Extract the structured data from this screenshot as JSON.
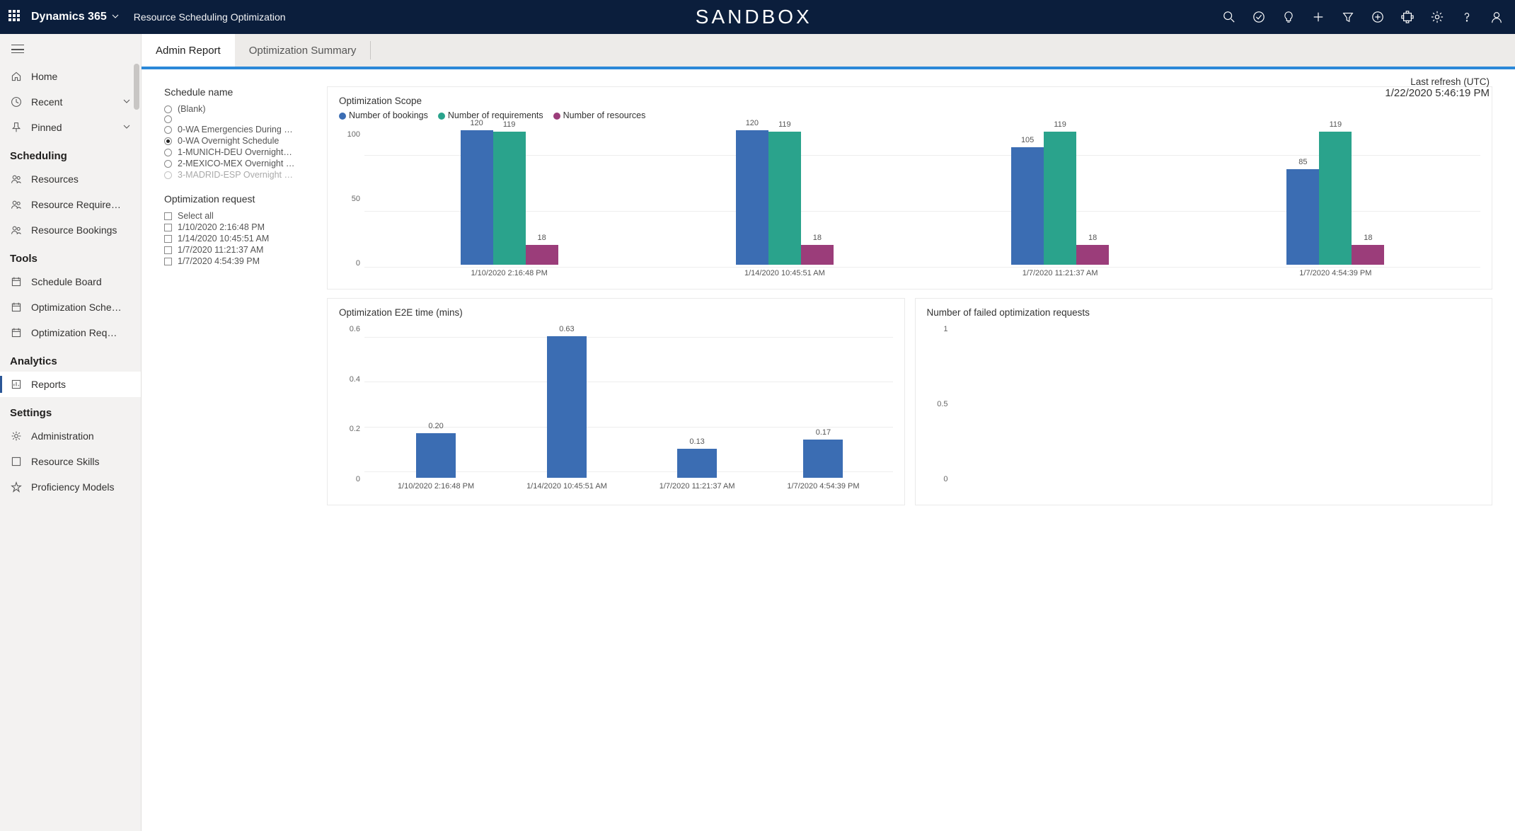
{
  "header": {
    "brand": "Dynamics 365",
    "app": "Resource Scheduling Optimization",
    "env_label": "SANDBOX"
  },
  "sidebar": {
    "top": [
      {
        "label": "Home",
        "icon": "home"
      },
      {
        "label": "Recent",
        "icon": "clock",
        "expandable": true
      },
      {
        "label": "Pinned",
        "icon": "pin",
        "expandable": true
      }
    ],
    "sections": [
      {
        "title": "Scheduling",
        "items": [
          {
            "label": "Resources"
          },
          {
            "label": "Resource Require…"
          },
          {
            "label": "Resource Bookings"
          }
        ]
      },
      {
        "title": "Tools",
        "items": [
          {
            "label": "Schedule Board"
          },
          {
            "label": "Optimization Sche…"
          },
          {
            "label": "Optimization Req…"
          }
        ]
      },
      {
        "title": "Analytics",
        "items": [
          {
            "label": "Reports",
            "active": true
          }
        ]
      },
      {
        "title": "Settings",
        "items": [
          {
            "label": "Administration"
          },
          {
            "label": "Resource Skills"
          },
          {
            "label": "Proficiency Models"
          }
        ]
      }
    ]
  },
  "tabs": {
    "active": "Admin Report",
    "other": "Optimization Summary"
  },
  "refresh": {
    "label": "Last refresh (UTC)",
    "value": "1/22/2020 5:46:19 PM"
  },
  "filters": {
    "schedule_name": {
      "title": "Schedule name",
      "options": [
        {
          "label": "(Blank)",
          "selected": false
        },
        {
          "label": "",
          "selected": false
        },
        {
          "label": "0-WA Emergencies During …",
          "selected": false
        },
        {
          "label": "0-WA Overnight Schedule",
          "selected": true
        },
        {
          "label": "1-MUNICH-DEU Overnight…",
          "selected": false
        },
        {
          "label": "2-MEXICO-MEX Overnight …",
          "selected": false
        },
        {
          "label": "3-MADRID-ESP Overnight …",
          "selected": false,
          "cut": true
        }
      ]
    },
    "optimization_request": {
      "title": "Optimization request",
      "options": [
        {
          "label": "Select all"
        },
        {
          "label": "1/10/2020 2:16:48 PM"
        },
        {
          "label": "1/14/2020 10:45:51 AM"
        },
        {
          "label": "1/7/2020 11:21:37 AM"
        },
        {
          "label": "1/7/2020 4:54:39 PM"
        }
      ]
    }
  },
  "chart_data": [
    {
      "id": "scope",
      "type": "bar",
      "title": "Optimization Scope",
      "legend": [
        {
          "name": "Number of bookings",
          "color": "#3b6db3"
        },
        {
          "name": "Number of requirements",
          "color": "#2aa38c"
        },
        {
          "name": "Number of resources",
          "color": "#9b3d7a"
        }
      ],
      "categories": [
        "1/10/2020 2:16:48 PM",
        "1/14/2020 10:45:51 AM",
        "1/7/2020 11:21:37 AM",
        "1/7/2020 4:54:39 PM"
      ],
      "series": [
        {
          "name": "Number of bookings",
          "values": [
            120,
            120,
            105,
            85
          ]
        },
        {
          "name": "Number of requirements",
          "values": [
            119,
            119,
            119,
            119
          ]
        },
        {
          "name": "Number of resources",
          "values": [
            18,
            18,
            18,
            18
          ]
        }
      ],
      "y_ticks": [
        0,
        50,
        100
      ],
      "ylim": [
        0,
        120
      ]
    },
    {
      "id": "e2e",
      "type": "bar",
      "title": "Optimization E2E time (mins)",
      "categories": [
        "1/10/2020 2:16:48 PM",
        "1/14/2020 10:45:51 AM",
        "1/7/2020 11:21:37 AM",
        "1/7/2020 4:54:39 PM"
      ],
      "values": [
        0.2,
        0.63,
        0.13,
        0.17
      ],
      "y_ticks": [
        0.0,
        0.2,
        0.4,
        0.6
      ],
      "ylim": [
        0,
        0.63
      ],
      "color": "#3b6db3"
    },
    {
      "id": "failed",
      "type": "bar",
      "title": "Number of failed optimization requests",
      "categories": [],
      "values": [],
      "y_ticks": [
        0.0,
        0.5,
        1.0
      ],
      "ylim": [
        0,
        1.0
      ]
    }
  ]
}
